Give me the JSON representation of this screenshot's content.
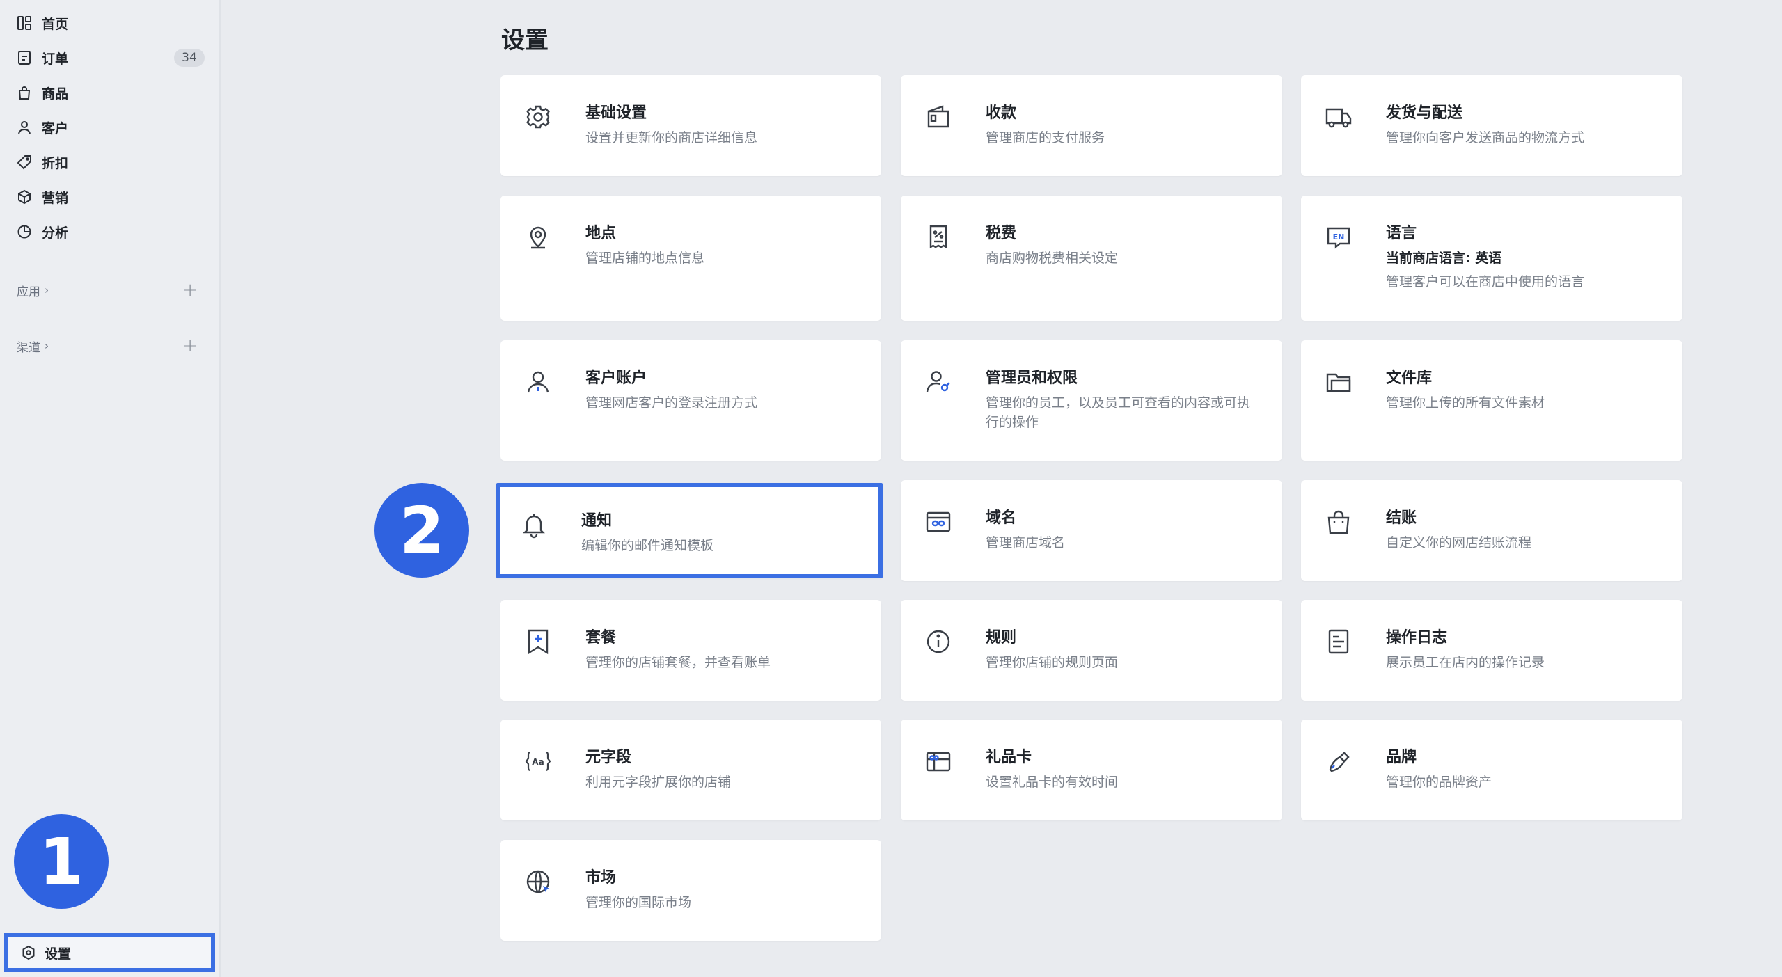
{
  "sidebar": {
    "items": [
      {
        "label": "首页",
        "icon": "dashboard-icon"
      },
      {
        "label": "订单",
        "icon": "order-icon",
        "badge": "34"
      },
      {
        "label": "商品",
        "icon": "bag-icon"
      },
      {
        "label": "客户",
        "icon": "user-icon"
      },
      {
        "label": "折扣",
        "icon": "tag-icon"
      },
      {
        "label": "营销",
        "icon": "cube-icon"
      },
      {
        "label": "分析",
        "icon": "pie-chart-icon"
      }
    ],
    "apps_label": "应用",
    "channels_label": "渠道",
    "settings_label": "设置"
  },
  "steps": {
    "one": "1",
    "two": "2"
  },
  "page": {
    "title": "设置"
  },
  "cards": [
    {
      "title": "基础设置",
      "desc": "设置并更新你的商店详细信息",
      "icon": "gear-icon"
    },
    {
      "title": "收款",
      "desc": "管理商店的支付服务",
      "icon": "wallet-icon"
    },
    {
      "title": "发货与配送",
      "desc": "管理你向客户发送商品的物流方式",
      "icon": "truck-icon"
    },
    {
      "title": "地点",
      "desc": "管理店铺的地点信息",
      "icon": "location-pin-icon"
    },
    {
      "title": "税费",
      "desc": "商店购物税费相关设定",
      "icon": "receipt-percent-icon"
    },
    {
      "title": "语言",
      "current": "当前商店语言: 英语",
      "desc": "管理客户可以在商店中使用的语言",
      "icon": "language-en-icon"
    },
    {
      "title": "客户账户",
      "desc": "管理网店客户的登录注册方式",
      "icon": "customer-account-icon"
    },
    {
      "title": "管理员和权限",
      "desc": "管理你的员工，以及员工可查看的内容或可执行的操作",
      "icon": "admin-permission-icon"
    },
    {
      "title": "文件库",
      "desc": "管理你上传的所有文件素材",
      "icon": "folder-icon"
    },
    {
      "title": "通知",
      "desc": "编辑你的邮件通知模板",
      "icon": "bell-icon"
    },
    {
      "title": "域名",
      "desc": "管理商店域名",
      "icon": "domain-icon"
    },
    {
      "title": "结账",
      "desc": "自定义你的网店结账流程",
      "icon": "shopping-bag-icon"
    },
    {
      "title": "套餐",
      "desc": "管理你的店铺套餐，并查看账单",
      "icon": "plan-bookmark-icon"
    },
    {
      "title": "规则",
      "desc": "管理你店铺的规则页面",
      "icon": "info-icon"
    },
    {
      "title": "操作日志",
      "desc": "展示员工在店内的操作记录",
      "icon": "log-icon"
    },
    {
      "title": "元字段",
      "desc": "利用元字段扩展你的店铺",
      "icon": "metafield-icon"
    },
    {
      "title": "礼品卡",
      "desc": "设置礼品卡的有效时间",
      "icon": "gift-card-icon"
    },
    {
      "title": "品牌",
      "desc": "管理你的品牌资产",
      "icon": "brand-icon"
    },
    {
      "title": "市场",
      "desc": "管理你的国际市场",
      "icon": "globe-icon"
    }
  ],
  "colors": {
    "accent": "#3b6fe3",
    "step_circle": "#2f62e0",
    "background": "#e9ebef"
  }
}
